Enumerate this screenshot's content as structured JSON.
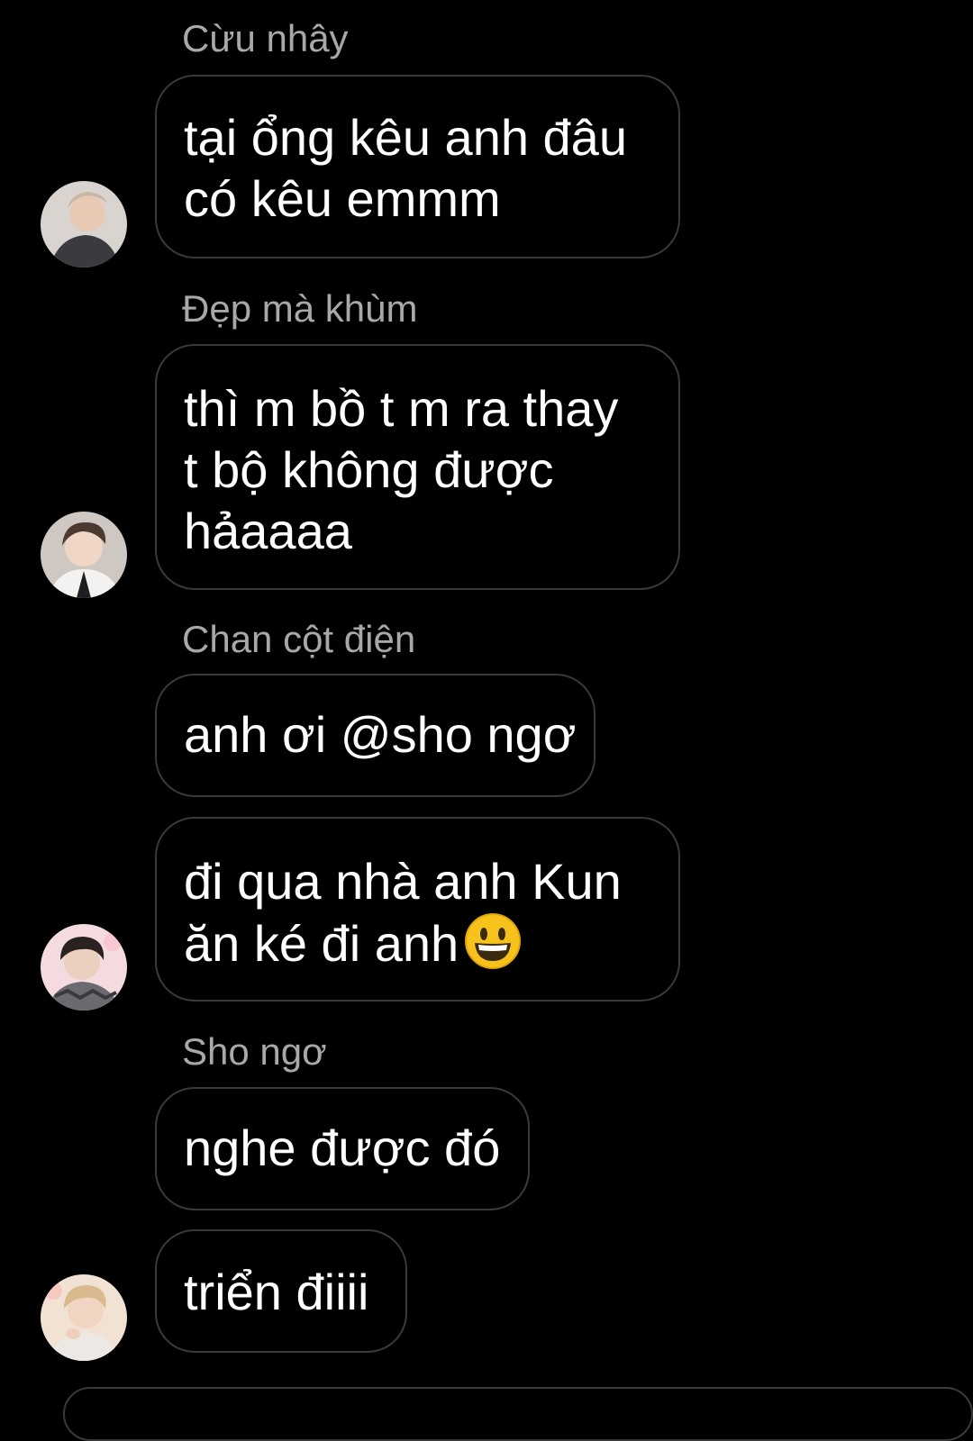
{
  "messages": [
    {
      "sender": "Cừu nhây",
      "lines": [
        "tại ổng kêu anh đâu",
        "có kêu emmm"
      ]
    },
    {
      "sender": "Đẹp mà khùm",
      "lines": [
        "thì m bồ t m ra thay",
        "t bộ không được",
        "hảaaaa"
      ]
    },
    {
      "sender": "Chan cột điện",
      "lines": [
        "anh ơi @sho ngơ"
      ]
    },
    {
      "sender": "",
      "lines": [
        "đi qua nhà anh Kun",
        "ăn ké đi anh"
      ],
      "emoji": "grinning-face-emoji"
    },
    {
      "sender": "Sho ngơ",
      "lines": [
        "nghe được đó"
      ]
    },
    {
      "sender": "",
      "lines": [
        "triển điiii"
      ]
    }
  ],
  "colors": {
    "background": "#000000",
    "bubble_border": "#3a3a3a",
    "sender_text": "#a8a8a8",
    "message_text": "#ffffff"
  }
}
